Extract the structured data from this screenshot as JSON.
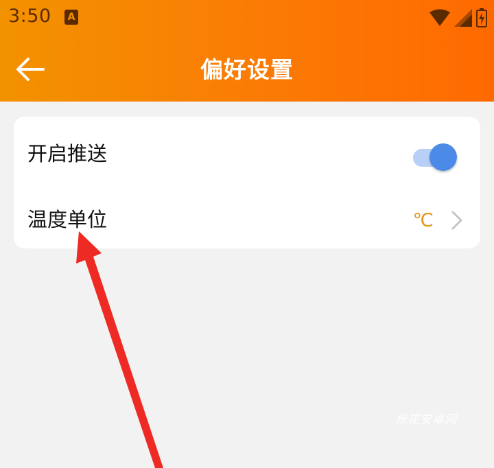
{
  "status_bar": {
    "time": "3:50",
    "notification_icon": "A"
  },
  "nav": {
    "title": "偏好设置",
    "back_icon": "arrow-left-icon"
  },
  "settings": {
    "push": {
      "label": "开启推送",
      "enabled": true
    },
    "temperature_unit": {
      "label": "温度单位",
      "value": "℃"
    }
  },
  "watermark": "标花安卓网",
  "colors": {
    "header_start": "#f39200",
    "header_end": "#ff6a00",
    "toggle_on": "#4c8ae8",
    "unit_value": "#e59417",
    "annotation_arrow": "#ee2a24"
  }
}
